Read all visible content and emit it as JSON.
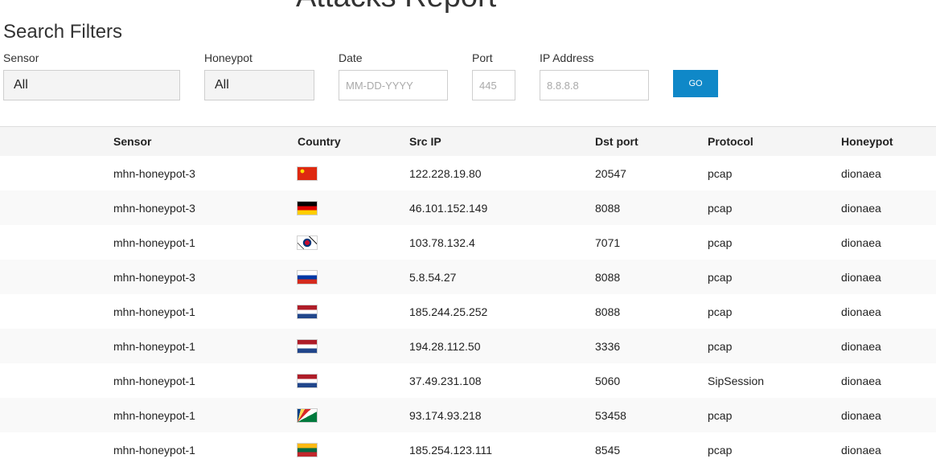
{
  "page_title": "Attacks Report",
  "filters": {
    "heading": "Search Filters",
    "sensor": {
      "label": "Sensor",
      "value": "All"
    },
    "honeypot": {
      "label": "Honeypot",
      "value": "All"
    },
    "date": {
      "label": "Date",
      "placeholder": "MM-DD-YYYY"
    },
    "port": {
      "label": "Port",
      "placeholder": "445"
    },
    "ip": {
      "label": "IP Address",
      "placeholder": "8.8.8.8"
    },
    "go_label": "GO",
    "go_color": "#0f88c8"
  },
  "table": {
    "columns": [
      "Sensor",
      "Country",
      "Src IP",
      "Dst port",
      "Protocol",
      "Honeypot"
    ],
    "rows": [
      {
        "sensor": "mhn-honeypot-3",
        "flag": "flag-china-icon",
        "src_ip": "122.228.19.80",
        "dst_port": "20547",
        "protocol": "pcap",
        "honeypot": "dionaea"
      },
      {
        "sensor": "mhn-honeypot-3",
        "flag": "flag-germany-icon",
        "src_ip": "46.101.152.149",
        "dst_port": "8088",
        "protocol": "pcap",
        "honeypot": "dionaea"
      },
      {
        "sensor": "mhn-honeypot-1",
        "flag": "flag-south-korea-icon",
        "src_ip": "103.78.132.4",
        "dst_port": "7071",
        "protocol": "pcap",
        "honeypot": "dionaea"
      },
      {
        "sensor": "mhn-honeypot-3",
        "flag": "flag-russia-icon",
        "src_ip": "5.8.54.27",
        "dst_port": "8088",
        "protocol": "pcap",
        "honeypot": "dionaea"
      },
      {
        "sensor": "mhn-honeypot-1",
        "flag": "flag-netherlands-icon",
        "src_ip": "185.244.25.252",
        "dst_port": "8088",
        "protocol": "pcap",
        "honeypot": "dionaea"
      },
      {
        "sensor": "mhn-honeypot-1",
        "flag": "flag-netherlands-icon",
        "src_ip": "194.28.112.50",
        "dst_port": "3336",
        "protocol": "pcap",
        "honeypot": "dionaea"
      },
      {
        "sensor": "mhn-honeypot-1",
        "flag": "flag-netherlands-icon",
        "src_ip": "37.49.231.108",
        "dst_port": "5060",
        "protocol": "SipSession",
        "honeypot": "dionaea"
      },
      {
        "sensor": "mhn-honeypot-1",
        "flag": "flag-seychelles-icon",
        "src_ip": "93.174.93.218",
        "dst_port": "53458",
        "protocol": "pcap",
        "honeypot": "dionaea"
      },
      {
        "sensor": "mhn-honeypot-1",
        "flag": "flag-lithuania-icon",
        "src_ip": "185.254.123.111",
        "dst_port": "8545",
        "protocol": "pcap",
        "honeypot": "dionaea"
      }
    ]
  }
}
